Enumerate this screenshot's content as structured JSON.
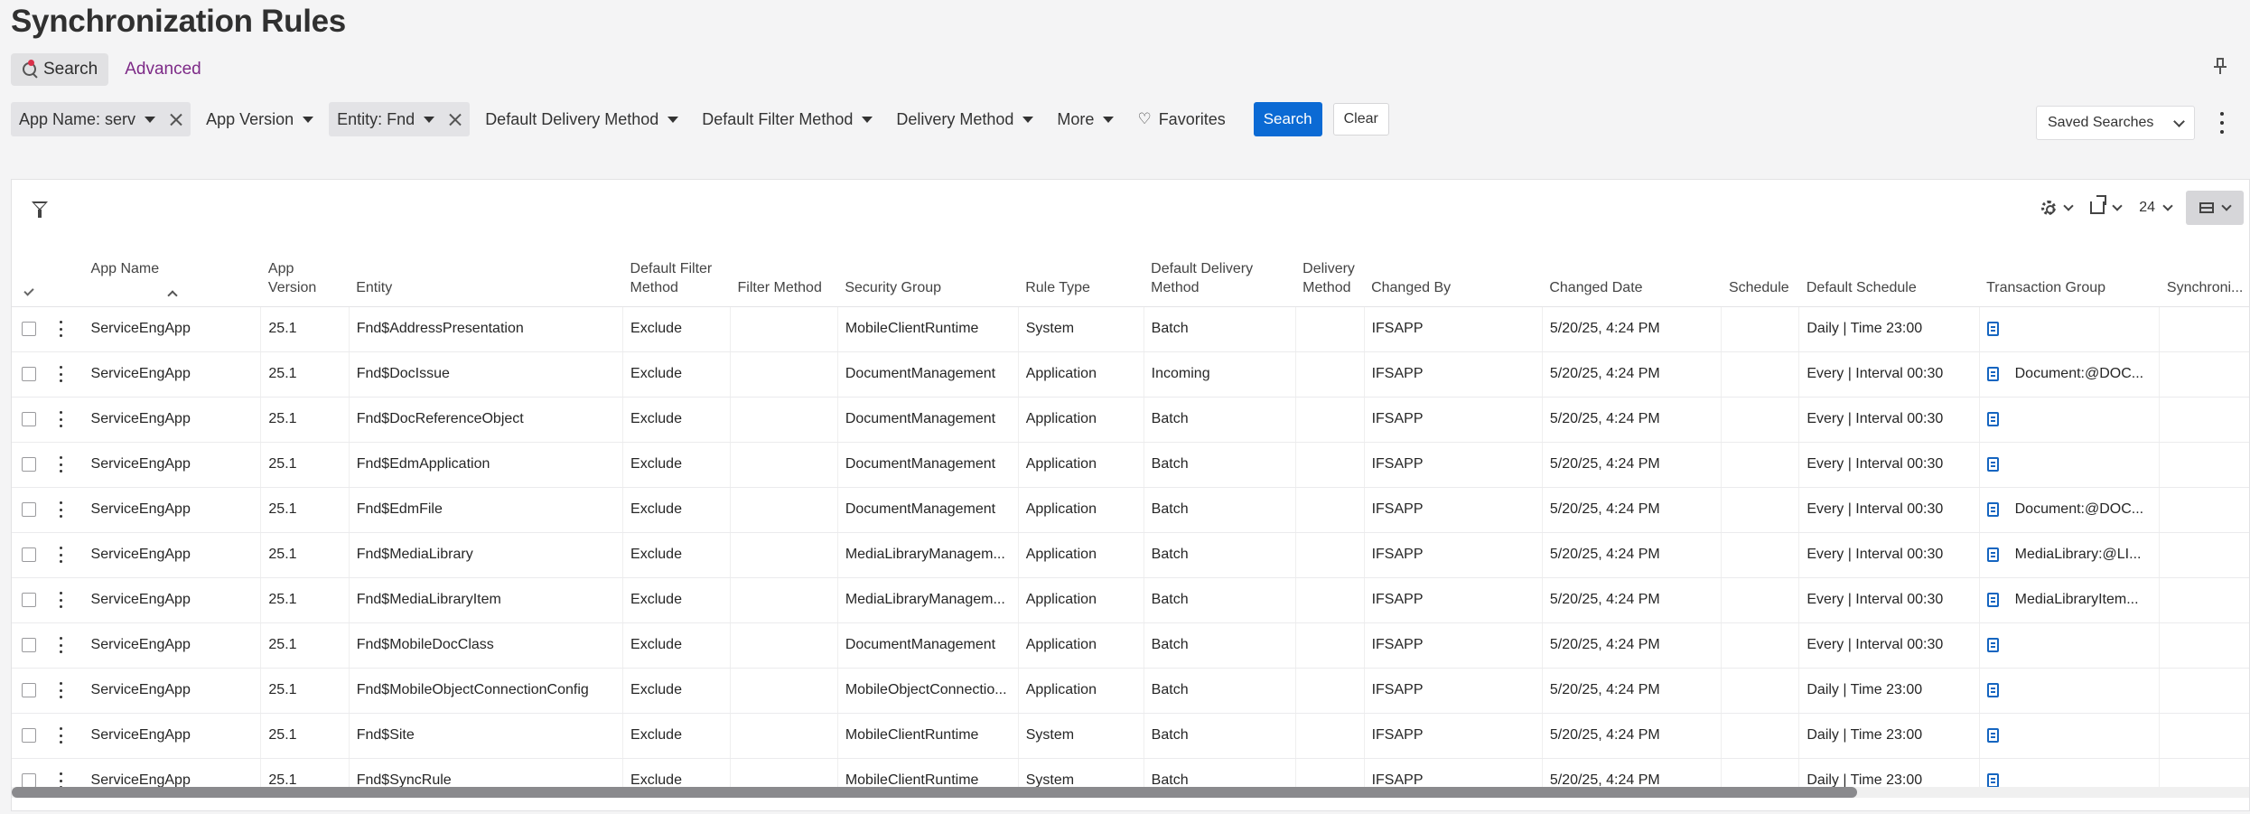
{
  "page": {
    "title": "Synchronization Rules"
  },
  "search_tabs": {
    "search": "Search",
    "advanced": "Advanced"
  },
  "filters": [
    {
      "label": "App Name: serv",
      "active": true,
      "clearable": true
    },
    {
      "label": "App Version",
      "active": false,
      "clearable": false
    },
    {
      "label": "Entity: Fnd",
      "active": true,
      "clearable": true
    },
    {
      "label": "Default Delivery Method",
      "active": false,
      "clearable": false
    },
    {
      "label": "Default Filter Method",
      "active": false,
      "clearable": false
    },
    {
      "label": "Delivery Method",
      "active": false,
      "clearable": false
    },
    {
      "label": "More",
      "active": false,
      "clearable": false
    }
  ],
  "favorites_label": "Favorites",
  "search_button": "Search",
  "clear_button": "Clear",
  "saved_searches": "Saved Searches",
  "toolbar": {
    "page_size": "24"
  },
  "columns": [
    {
      "key": "app_name",
      "label": "App Name"
    },
    {
      "key": "app_version",
      "label": "App Version"
    },
    {
      "key": "entity",
      "label": "Entity"
    },
    {
      "key": "default_filter_method",
      "label": "Default Filter Method"
    },
    {
      "key": "filter_method",
      "label": "Filter Method"
    },
    {
      "key": "security_group",
      "label": "Security Group"
    },
    {
      "key": "rule_type",
      "label": "Rule Type"
    },
    {
      "key": "default_delivery_method",
      "label": "Default Delivery Method"
    },
    {
      "key": "delivery_method",
      "label": "Delivery Method"
    },
    {
      "key": "changed_by",
      "label": "Changed By"
    },
    {
      "key": "changed_date",
      "label": "Changed Date"
    },
    {
      "key": "schedule",
      "label": "Schedule"
    },
    {
      "key": "default_schedule",
      "label": "Default Schedule"
    },
    {
      "key": "transaction_group",
      "label": "Transaction Group"
    },
    {
      "key": "synchronization",
      "label": "Synchroni..."
    }
  ],
  "rows": [
    {
      "app_name": "ServiceEngApp",
      "app_version": "25.1",
      "entity": "Fnd$AddressPresentation",
      "default_filter_method": "Exclude",
      "filter_method": "",
      "security_group": "MobileClientRuntime",
      "rule_type": "System",
      "default_delivery_method": "Batch",
      "delivery_method": "",
      "changed_by": "IFSAPP",
      "changed_date": "5/20/25, 4:24 PM",
      "schedule": "",
      "default_schedule": "Daily | Time 23:00",
      "transaction_group": "",
      "synchronization": ""
    },
    {
      "app_name": "ServiceEngApp",
      "app_version": "25.1",
      "entity": "Fnd$DocIssue",
      "default_filter_method": "Exclude",
      "filter_method": "",
      "security_group": "DocumentManagement",
      "rule_type": "Application",
      "default_delivery_method": "Incoming",
      "delivery_method": "",
      "changed_by": "IFSAPP",
      "changed_date": "5/20/25, 4:24 PM",
      "schedule": "",
      "default_schedule": "Every | Interval 00:30",
      "transaction_group": "Document:@DOC...",
      "synchronization": ""
    },
    {
      "app_name": "ServiceEngApp",
      "app_version": "25.1",
      "entity": "Fnd$DocReferenceObject",
      "default_filter_method": "Exclude",
      "filter_method": "",
      "security_group": "DocumentManagement",
      "rule_type": "Application",
      "default_delivery_method": "Batch",
      "delivery_method": "",
      "changed_by": "IFSAPP",
      "changed_date": "5/20/25, 4:24 PM",
      "schedule": "",
      "default_schedule": "Every | Interval 00:30",
      "transaction_group": "",
      "synchronization": ""
    },
    {
      "app_name": "ServiceEngApp",
      "app_version": "25.1",
      "entity": "Fnd$EdmApplication",
      "default_filter_method": "Exclude",
      "filter_method": "",
      "security_group": "DocumentManagement",
      "rule_type": "Application",
      "default_delivery_method": "Batch",
      "delivery_method": "",
      "changed_by": "IFSAPP",
      "changed_date": "5/20/25, 4:24 PM",
      "schedule": "",
      "default_schedule": "Every | Interval 00:30",
      "transaction_group": "",
      "synchronization": ""
    },
    {
      "app_name": "ServiceEngApp",
      "app_version": "25.1",
      "entity": "Fnd$EdmFile",
      "default_filter_method": "Exclude",
      "filter_method": "",
      "security_group": "DocumentManagement",
      "rule_type": "Application",
      "default_delivery_method": "Batch",
      "delivery_method": "",
      "changed_by": "IFSAPP",
      "changed_date": "5/20/25, 4:24 PM",
      "schedule": "",
      "default_schedule": "Every | Interval 00:30",
      "transaction_group": "Document:@DOC...",
      "synchronization": ""
    },
    {
      "app_name": "ServiceEngApp",
      "app_version": "25.1",
      "entity": "Fnd$MediaLibrary",
      "default_filter_method": "Exclude",
      "filter_method": "",
      "security_group": "MediaLibraryManagem...",
      "rule_type": "Application",
      "default_delivery_method": "Batch",
      "delivery_method": "",
      "changed_by": "IFSAPP",
      "changed_date": "5/20/25, 4:24 PM",
      "schedule": "",
      "default_schedule": "Every | Interval 00:30",
      "transaction_group": "MediaLibrary:@LI...",
      "synchronization": ""
    },
    {
      "app_name": "ServiceEngApp",
      "app_version": "25.1",
      "entity": "Fnd$MediaLibraryItem",
      "default_filter_method": "Exclude",
      "filter_method": "",
      "security_group": "MediaLibraryManagem...",
      "rule_type": "Application",
      "default_delivery_method": "Batch",
      "delivery_method": "",
      "changed_by": "IFSAPP",
      "changed_date": "5/20/25, 4:24 PM",
      "schedule": "",
      "default_schedule": "Every | Interval 00:30",
      "transaction_group": "MediaLibraryItem...",
      "synchronization": ""
    },
    {
      "app_name": "ServiceEngApp",
      "app_version": "25.1",
      "entity": "Fnd$MobileDocClass",
      "default_filter_method": "Exclude",
      "filter_method": "",
      "security_group": "DocumentManagement",
      "rule_type": "Application",
      "default_delivery_method": "Batch",
      "delivery_method": "",
      "changed_by": "IFSAPP",
      "changed_date": "5/20/25, 4:24 PM",
      "schedule": "",
      "default_schedule": "Every | Interval 00:30",
      "transaction_group": "",
      "synchronization": ""
    },
    {
      "app_name": "ServiceEngApp",
      "app_version": "25.1",
      "entity": "Fnd$MobileObjectConnectionConfig",
      "default_filter_method": "Exclude",
      "filter_method": "",
      "security_group": "MobileObjectConnectio...",
      "rule_type": "Application",
      "default_delivery_method": "Batch",
      "delivery_method": "",
      "changed_by": "IFSAPP",
      "changed_date": "5/20/25, 4:24 PM",
      "schedule": "",
      "default_schedule": "Daily | Time 23:00",
      "transaction_group": "",
      "synchronization": ""
    },
    {
      "app_name": "ServiceEngApp",
      "app_version": "25.1",
      "entity": "Fnd$Site",
      "default_filter_method": "Exclude",
      "filter_method": "",
      "security_group": "MobileClientRuntime",
      "rule_type": "System",
      "default_delivery_method": "Batch",
      "delivery_method": "",
      "changed_by": "IFSAPP",
      "changed_date": "5/20/25, 4:24 PM",
      "schedule": "",
      "default_schedule": "Daily | Time 23:00",
      "transaction_group": "",
      "synchronization": ""
    },
    {
      "app_name": "ServiceEngApp",
      "app_version": "25.1",
      "entity": "Fnd$SyncRule",
      "default_filter_method": "Exclude",
      "filter_method": "",
      "security_group": "MobileClientRuntime",
      "rule_type": "System",
      "default_delivery_method": "Batch",
      "delivery_method": "",
      "changed_by": "IFSAPP",
      "changed_date": "5/20/25, 4:24 PM",
      "schedule": "",
      "default_schedule": "Daily | Time 23:00",
      "transaction_group": "",
      "synchronization": ""
    }
  ],
  "colors": {
    "primary": "#0b6ad4",
    "advanced_link": "#7d2a87",
    "doc_icon": "#1565c0"
  }
}
